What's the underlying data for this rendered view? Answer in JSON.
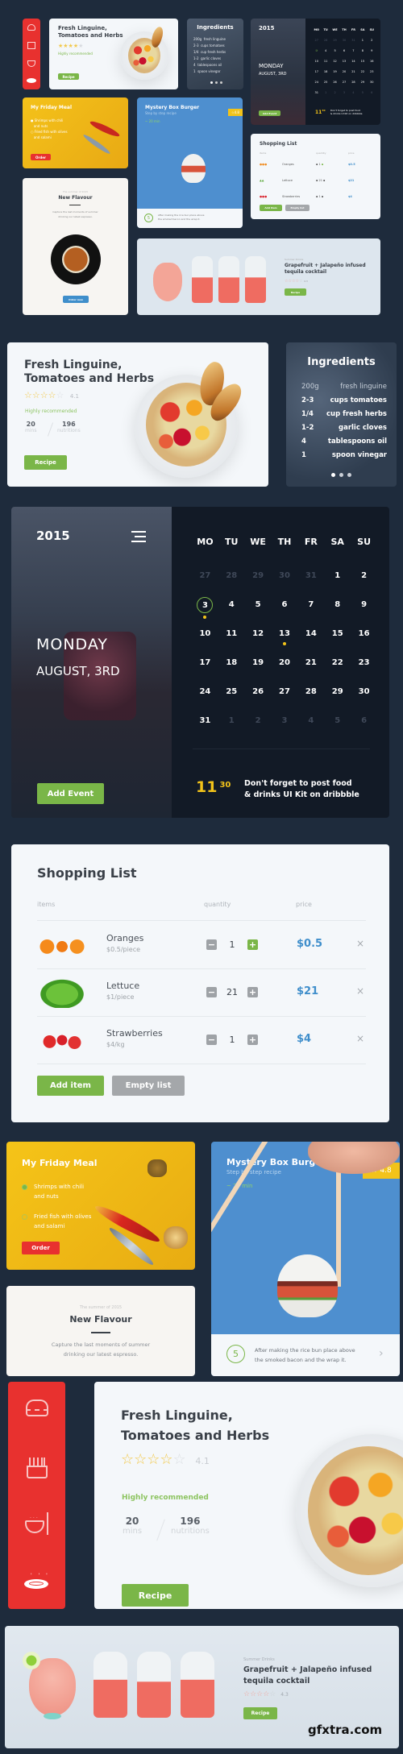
{
  "colors": {
    "background": "#1e2b3c",
    "accent_green": "#7ab648",
    "accent_red": "#e8312f",
    "accent_yellow": "#f2c31a",
    "accent_blue": "#3f8ecb",
    "price_blue": "#3f8ecb"
  },
  "sidebar": {
    "icons": [
      "burger-icon",
      "fries-icon",
      "noodle-bowl-icon",
      "hot-dish-icon"
    ]
  },
  "linguine": {
    "title_line1": "Fresh Linguine,",
    "title_line2": "Tomatoes and Herbs",
    "rating": "4.1",
    "stars_filled": 4,
    "stars_total": 5,
    "recommendation": "Highly recommended",
    "stat1_value": "20",
    "stat1_label": "mins",
    "stat2_value": "196",
    "stat2_label": "nutritions",
    "button": "Recipe"
  },
  "ingredients": {
    "title": "Ingredients",
    "items": [
      {
        "qty": "200g",
        "name": "fresh linguine"
      },
      {
        "qty": "2-3",
        "name": "cups tomatoes"
      },
      {
        "qty": "1/4",
        "name": "cup fresh herbs"
      },
      {
        "qty": "1-2",
        "name": "garlic cloves"
      },
      {
        "qty": "4",
        "name": "tablespoons oil"
      },
      {
        "qty": "1",
        "name": "spoon vinegar"
      }
    ],
    "pages": 3,
    "active_page": 1
  },
  "calendar": {
    "year": "2015",
    "weekday": "MONDAY",
    "date": "AUGUST, 3RD",
    "add_button": "Add Event",
    "day_headers": [
      "MO",
      "TU",
      "WE",
      "TH",
      "FR",
      "SA",
      "SU"
    ],
    "weeks": [
      [
        {
          "d": "27",
          "muted": true
        },
        {
          "d": "28",
          "muted": true
        },
        {
          "d": "29",
          "muted": true
        },
        {
          "d": "30",
          "muted": true
        },
        {
          "d": "31",
          "muted": true
        },
        {
          "d": "1"
        },
        {
          "d": "2"
        }
      ],
      [
        {
          "d": "3",
          "selected": true,
          "event": true
        },
        {
          "d": "4"
        },
        {
          "d": "5"
        },
        {
          "d": "6"
        },
        {
          "d": "7"
        },
        {
          "d": "8"
        },
        {
          "d": "9"
        }
      ],
      [
        {
          "d": "10"
        },
        {
          "d": "11"
        },
        {
          "d": "12"
        },
        {
          "d": "13",
          "event": true
        },
        {
          "d": "14"
        },
        {
          "d": "15"
        },
        {
          "d": "16"
        }
      ],
      [
        {
          "d": "17"
        },
        {
          "d": "18"
        },
        {
          "d": "19"
        },
        {
          "d": "20"
        },
        {
          "d": "21"
        },
        {
          "d": "22"
        },
        {
          "d": "23"
        }
      ],
      [
        {
          "d": "24"
        },
        {
          "d": "25"
        },
        {
          "d": "26"
        },
        {
          "d": "27"
        },
        {
          "d": "28"
        },
        {
          "d": "29"
        },
        {
          "d": "30"
        }
      ],
      [
        {
          "d": "31"
        },
        {
          "d": "1",
          "muted": true
        },
        {
          "d": "2",
          "muted": true
        },
        {
          "d": "3",
          "muted": true
        },
        {
          "d": "4",
          "muted": true
        },
        {
          "d": "5",
          "muted": true
        },
        {
          "d": "6",
          "muted": true
        }
      ]
    ],
    "reminder_hour": "11",
    "reminder_minute": "30",
    "reminder_text_line1": "Don't forget to post food",
    "reminder_text_line2": "& drinks UI Kit on dribbble"
  },
  "shopping": {
    "title": "Shopping List",
    "columns": [
      "items",
      "quantity",
      "price"
    ],
    "rows": [
      {
        "name": "Oranges",
        "unit": "$0.5/piece",
        "qty": "1",
        "price": "$0.5",
        "image": "oranges"
      },
      {
        "name": "Lettuce",
        "unit": "$1/piece",
        "qty": "21",
        "price": "$21",
        "image": "lettuce"
      },
      {
        "name": "Strawberries",
        "unit": "$4/kg",
        "qty": "1",
        "price": "$4",
        "image": "strawberries"
      }
    ],
    "add_button": "Add item",
    "empty_button": "Empty list"
  },
  "friday": {
    "title": "My Friday Meal",
    "items": [
      {
        "line1": "Shrimps  with chili",
        "line2": "and nuts",
        "checked": true
      },
      {
        "line1": "Fried fish with olives",
        "line2": "and salami",
        "checked": false
      }
    ],
    "button": "Order"
  },
  "flavour": {
    "eyebrow": "The summer of 2015",
    "title": "New Flavour",
    "desc_line1": "Capture the last moments of summer",
    "desc_line2": "drinking our latest espresso.",
    "button": "Order now"
  },
  "burger": {
    "title": "Mystery Box Burger",
    "subtitle": "Step by step recipe",
    "time": "~ 20 min",
    "rating": "4.8",
    "step": "5",
    "step_text_line1": "After making the rice bun place above",
    "step_text_line2": "the smoked bacon and the wrap it."
  },
  "cocktail": {
    "eyebrow": "Summer Drinks",
    "title_line1": "Grapefruit + Jalapeño infused",
    "title_line2": "tequila cocktail",
    "rating": "4.3",
    "stars_filled": 4,
    "button": "Recipe"
  },
  "watermark": "gfxtra.com"
}
